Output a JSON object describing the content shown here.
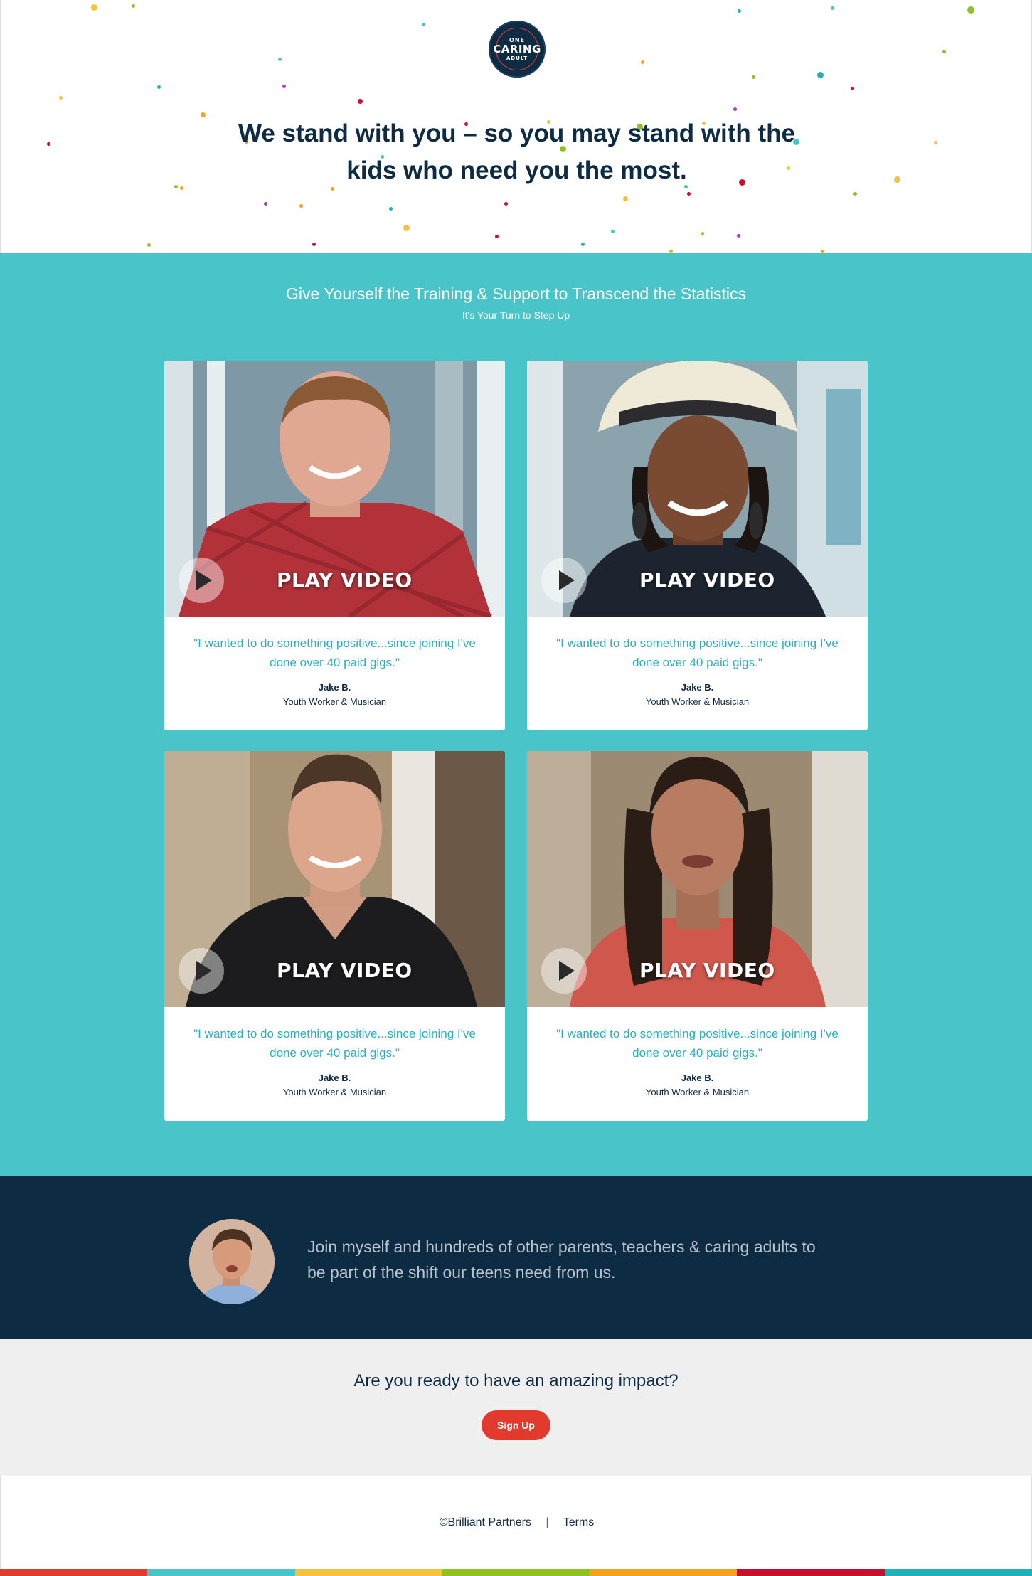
{
  "logo": {
    "line1": "ONE",
    "line2": "CARING",
    "line3": "ADULT"
  },
  "hero": {
    "title": "We stand with you – so you may stand with the kids who need you the most."
  },
  "intro": {
    "heading": "Give Yourself the Training & Support to Transcend the Statistics",
    "subheading": "It's Your Turn to Step Up"
  },
  "cards": [
    {
      "play_label": "PLAY VIDEO",
      "quote": "\"I wanted to do something positive...since joining I've done over 40 paid gigs.\"",
      "name": "Jake B.",
      "role": "Youth Worker & Musician",
      "photo_icon": "man-plaid-shirt-portrait"
    },
    {
      "play_label": "PLAY VIDEO",
      "quote": "\"I wanted to do something positive...since joining I've done over 40 paid gigs.\"",
      "name": "Jake B.",
      "role": "Youth Worker & Musician",
      "photo_icon": "woman-hat-portrait"
    },
    {
      "play_label": "PLAY VIDEO",
      "quote": "\"I wanted to do something positive...since joining I've done over 40 paid gigs.\"",
      "name": "Jake B.",
      "role": "Youth Worker & Musician",
      "photo_icon": "man-black-tshirt-portrait"
    },
    {
      "play_label": "PLAY VIDEO",
      "quote": "\"I wanted to do something positive...since joining I've done over 40 paid gigs.\"",
      "name": "Jake B.",
      "role": "Youth Worker & Musician",
      "photo_icon": "woman-red-top-portrait"
    }
  ],
  "testimonial": {
    "text": "Join myself and hundreds of other parents, teachers & caring adults to be part of the shift our teens need from us."
  },
  "cta": {
    "question": "Are you ready to have an amazing impact?",
    "button": "Sign Up"
  },
  "footer": {
    "copyright": "©Brilliant Partners",
    "separator": "|",
    "terms": "Terms"
  },
  "colors": {
    "navy": "#0e2b44",
    "teal": "#49c5ca",
    "red": "#e23b2e",
    "quote_teal": "#2aaec0",
    "stripe": [
      "#e23b2e",
      "#49c5ca",
      "#f6c23e",
      "#8dc21f",
      "#f4a31d",
      "#c8102e",
      "#1fb0b8"
    ]
  }
}
